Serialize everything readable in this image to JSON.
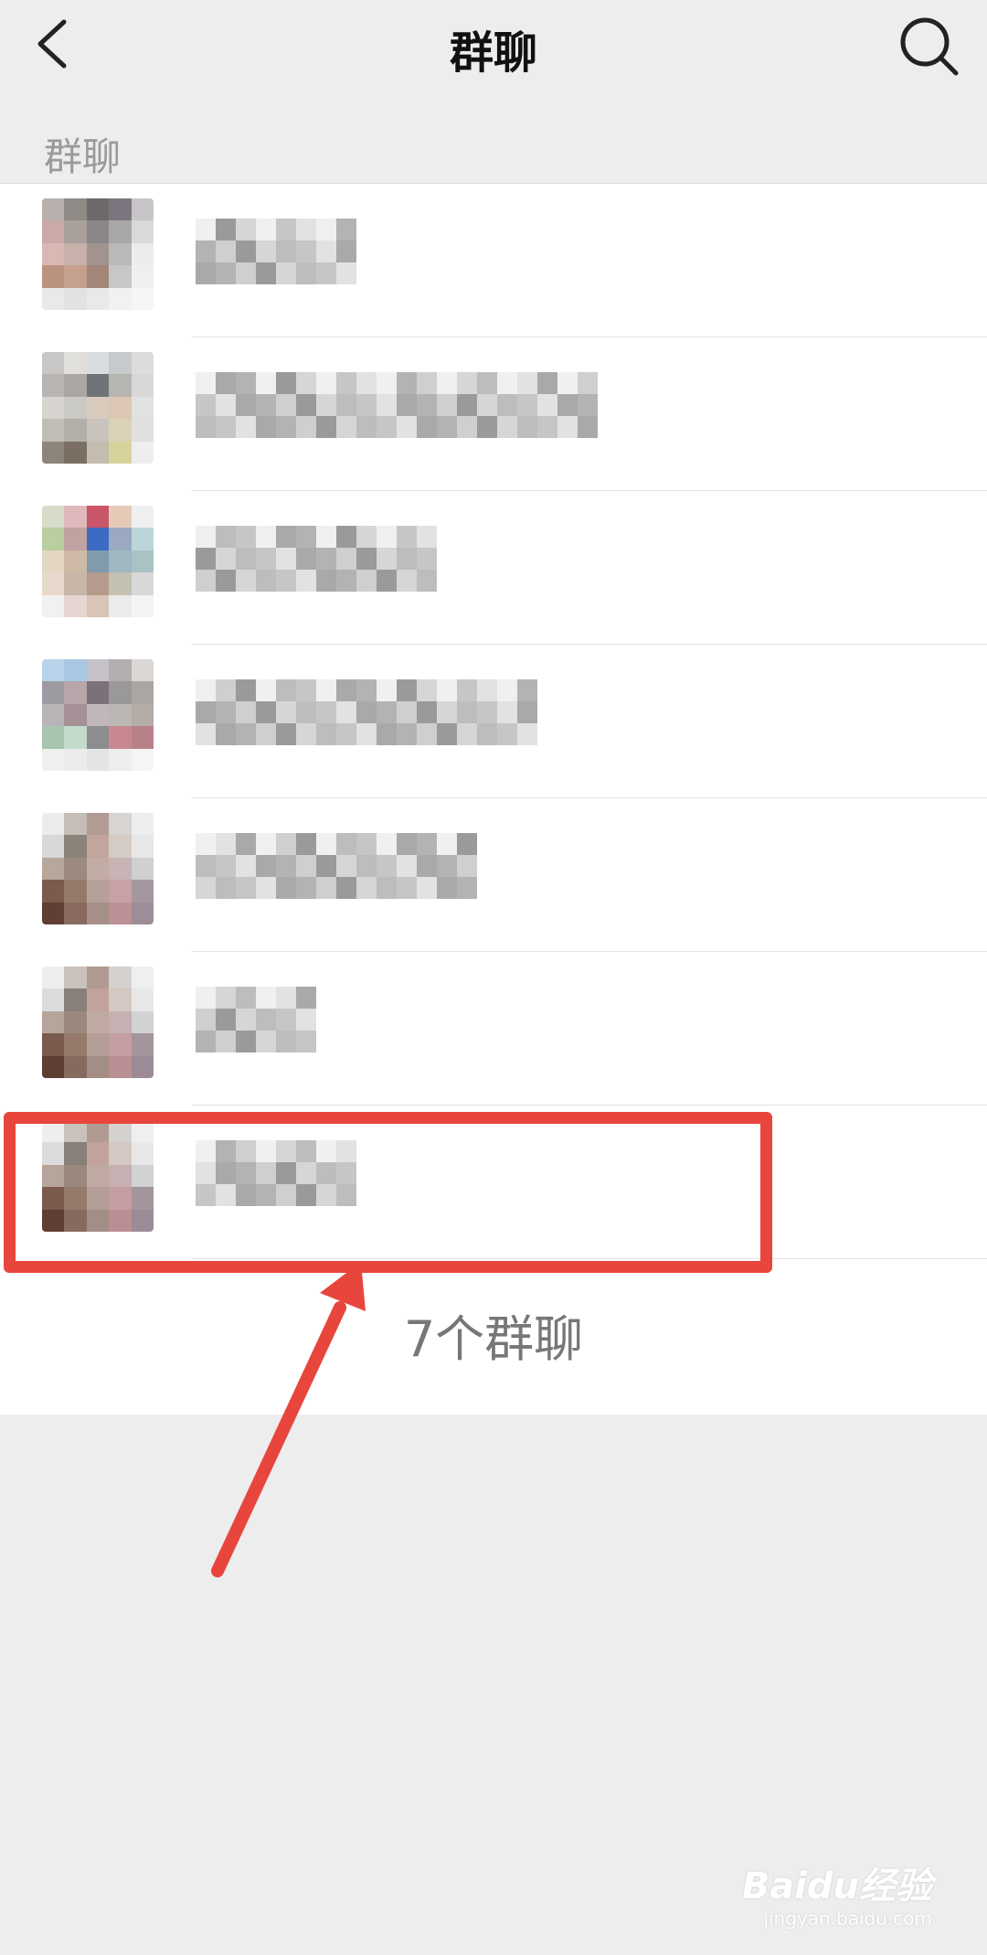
{
  "header": {
    "title": "群聊",
    "back_icon": "chevron-left-icon",
    "search_icon": "search-icon"
  },
  "section": {
    "label": "群聊"
  },
  "group_list": {
    "items": [
      {
        "name_blurred": true,
        "avatar_palette": [
          "#b7b0ad",
          "#8f8a86",
          "#6e6a6c",
          "#7b7580",
          "#c7c5c8",
          "#c9aaa8",
          "#a99f9b",
          "#8b8787",
          "#a8a6a8",
          "#d9d9d9",
          "#d9b7b2",
          "#c7b1aa",
          "#a2938f",
          "#bbb8b8",
          "#ececec",
          "#b99280",
          "#c5a08e",
          "#a48679",
          "#c7c7c7",
          "#efefef",
          "#e9e9e9",
          "#e2e2e2",
          "#e9e9e9",
          "#f1f1f1",
          "#f6f6f6"
        ]
      },
      {
        "name_blurred": true,
        "avatar_palette": [
          "#c9c7c5",
          "#e0dfdc",
          "#d9dde1",
          "#c8cbce",
          "#dcdcdc",
          "#b8b4b1",
          "#a9a6a3",
          "#6f7576",
          "#b7b5b0",
          "#d8d8d8",
          "#d7d4d0",
          "#cac9c6",
          "#d8cbbd",
          "#dbc7b4",
          "#e1e1e1",
          "#c0bdb6",
          "#b1afa8",
          "#c8c3bc",
          "#d9d2b7",
          "#e0e0e0",
          "#8c857c",
          "#7b6f63",
          "#c4bcae",
          "#d8d39c",
          "#eeeeee"
        ]
      },
      {
        "name_blurred": true,
        "avatar_palette": [
          "#d7dcc8",
          "#e0b8bb",
          "#c9556a",
          "#e5cbb7",
          "#efefef",
          "#b9cfa0",
          "#c0a3a1",
          "#3d6bc3",
          "#9aa8c1",
          "#bcd5d9",
          "#e3d7c2",
          "#cdb9a5",
          "#819aae",
          "#9fb8c1",
          "#a9c3c4",
          "#e8d9cd",
          "#c8b7a8",
          "#b59b8b",
          "#c4c0b2",
          "#d8d8d8",
          "#f1f1f1",
          "#e6d6d1",
          "#d8c5b7",
          "#ebebeb",
          "#f4f4f4"
        ]
      },
      {
        "name_blurred": true,
        "avatar_palette": [
          "#b8d3ea",
          "#a9c7e2",
          "#c4c2c6",
          "#b2aeb2",
          "#d9d6d4",
          "#9d9aa1",
          "#b7a5a9",
          "#7c7178",
          "#9b989a",
          "#a9a6a4",
          "#b9b4b7",
          "#a49095",
          "#c1b7ba",
          "#bbb8b3",
          "#b3aca7",
          "#a7c6ad",
          "#c2dbcb",
          "#8d8c8e",
          "#c9888f",
          "#b8818a",
          "#efefef",
          "#ececec",
          "#e4e4e4",
          "#eeeeee",
          "#f5f5f5"
        ]
      },
      {
        "name_blurred": true,
        "avatar_palette": [
          "#ececec",
          "#c5beb6",
          "#b19c93",
          "#d7d4d1",
          "#eeeeee",
          "#d8d8d8",
          "#8a837a",
          "#c2a59d",
          "#d5cbc5",
          "#e7e7e7",
          "#b8a89c",
          "#9c8a80",
          "#c2aca3",
          "#c8b3b5",
          "#d0d0d0",
          "#7b5b4e",
          "#957a6c",
          "#b6a098",
          "#c8a1a6",
          "#a5979f",
          "#613e34",
          "#886a5f",
          "#a58f87",
          "#bb9195",
          "#9e8c98"
        ]
      },
      {
        "name_blurred": true,
        "avatar_palette": [
          "#eeeeee",
          "#c9c2bb",
          "#b09b92",
          "#d5d1ce",
          "#efefef",
          "#dcdcdc",
          "#888078",
          "#c1a39b",
          "#d3c8c2",
          "#e8e8e8",
          "#b6a59a",
          "#9a887e",
          "#bfa9a0",
          "#c6b0b2",
          "#d2d2d2",
          "#7a5a4d",
          "#95796b",
          "#b49e95",
          "#c59ea3",
          "#a39599",
          "#603d33",
          "#876a5e",
          "#a38d84",
          "#b98f93",
          "#9c8b96"
        ]
      },
      {
        "name_blurred": true,
        "avatar_palette": [
          "#eeeeee",
          "#c9c2bb",
          "#b09b92",
          "#d5d1ce",
          "#efefef",
          "#dcdcdc",
          "#888078",
          "#c1a39b",
          "#d3c8c2",
          "#e8e8e8",
          "#b6a59a",
          "#9a887e",
          "#bfa9a0",
          "#c6b0b2",
          "#d2d2d2",
          "#7a5a4d",
          "#95796b",
          "#b49e95",
          "#c59ea3",
          "#a39599",
          "#603d33",
          "#876a5e",
          "#a38d84",
          "#b98f93",
          "#9c8b96"
        ]
      }
    ]
  },
  "footer": {
    "count_text": "7个群聊"
  },
  "annotation": {
    "highlight_color": "#e8453c",
    "highlighted_item_index": 6
  },
  "watermark": {
    "brand": "Baidu经验",
    "url": "jingyan.baidu.com"
  }
}
